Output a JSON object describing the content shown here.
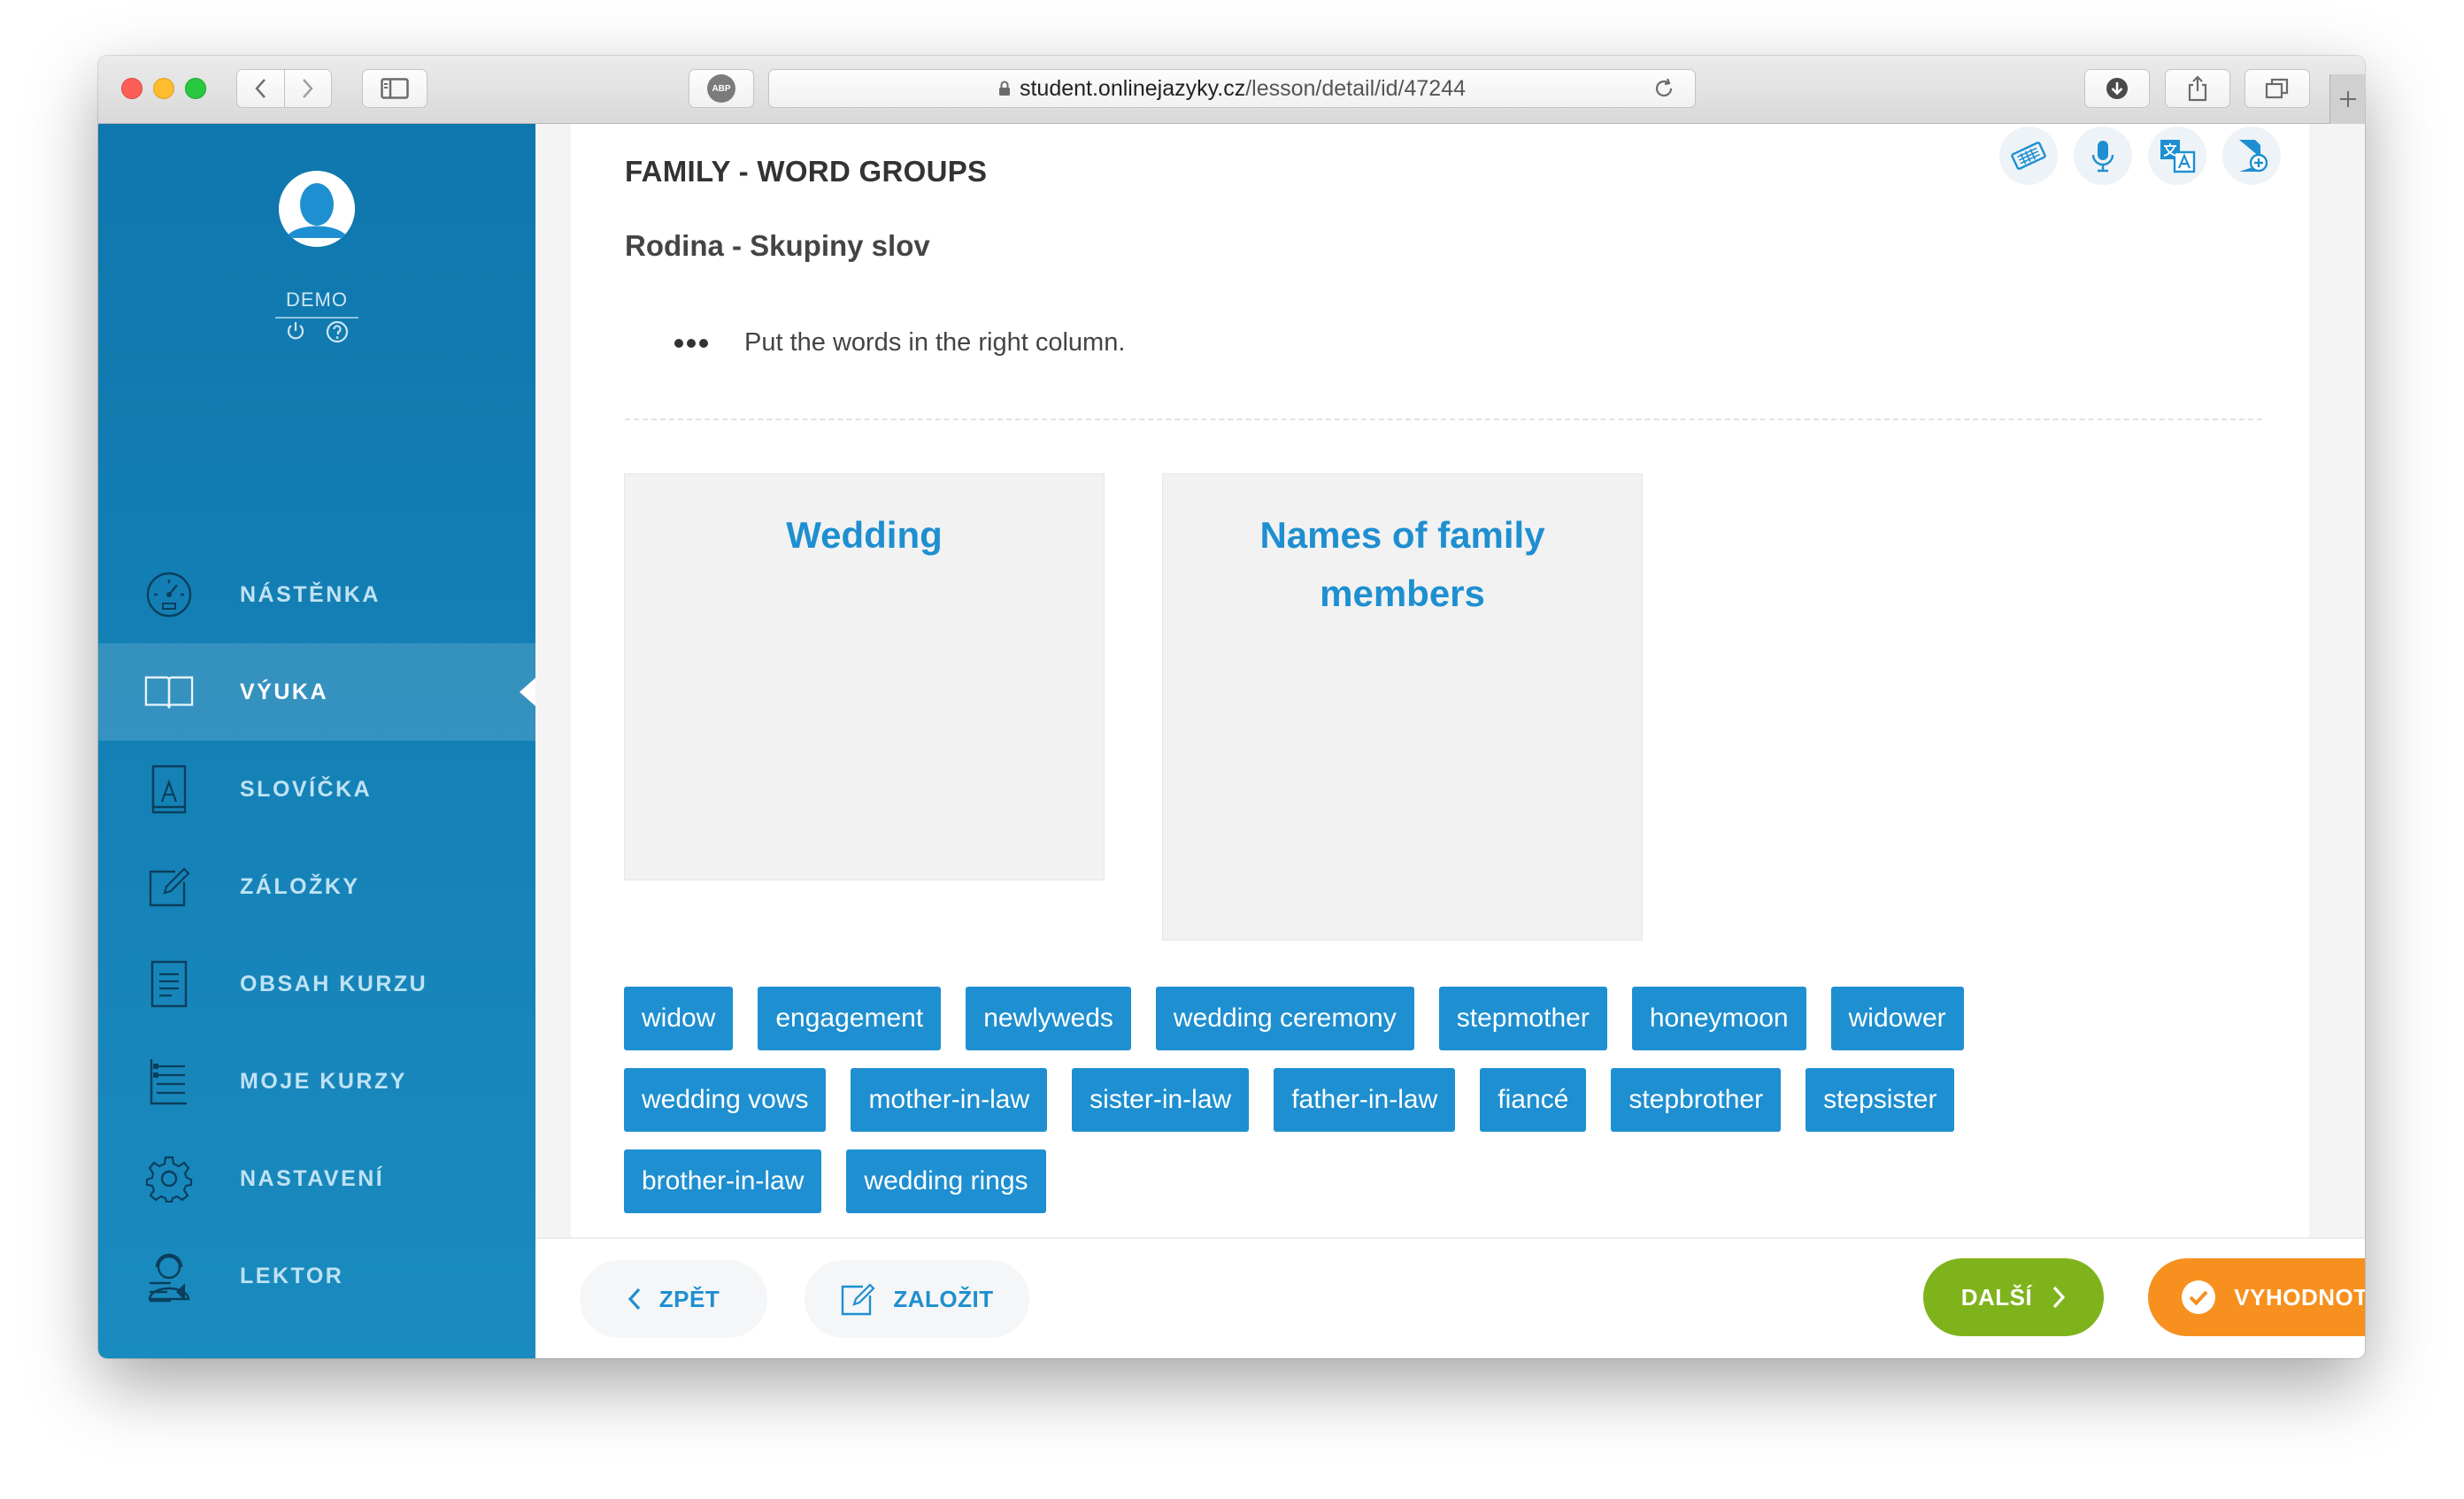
{
  "browser": {
    "url_host": "student.onlinejazyky.cz",
    "url_path": "/lesson/detail/id/47244",
    "adblock_label": "ABP"
  },
  "user": {
    "name": "DEMO"
  },
  "sidebar": {
    "items": [
      {
        "label": "NÁSTĚNKA",
        "icon": "dashboard-icon"
      },
      {
        "label": "VÝUKA",
        "icon": "book-icon",
        "active": true
      },
      {
        "label": "SLOVÍČKA",
        "icon": "vocabulary-icon"
      },
      {
        "label": "ZÁLOŽKY",
        "icon": "bookmark-edit-icon"
      },
      {
        "label": "OBSAH KURZU",
        "icon": "course-content-icon"
      },
      {
        "label": "MOJE KURZY",
        "icon": "my-courses-icon"
      },
      {
        "label": "NASTAVENÍ",
        "icon": "settings-gear-icon"
      },
      {
        "label": "LEKTOR",
        "icon": "tutor-icon"
      }
    ]
  },
  "lesson": {
    "title": "FAMILY - WORD GROUPS",
    "subtitle": "Rodina - Skupiny slov",
    "instruction": "Put the words in the right column.",
    "columns": [
      {
        "heading": "Wedding"
      },
      {
        "heading": "Names of family members"
      }
    ],
    "words": [
      [
        "widow",
        "engagement",
        "newlyweds",
        "wedding ceremony",
        "stepmother",
        "honeymoon",
        "widower"
      ],
      [
        "wedding vows",
        "mother-in-law",
        "sister-in-law",
        "father-in-law",
        "fiancé",
        "stepbrother",
        "stepsister"
      ],
      [
        "brother-in-law",
        "wedding rings"
      ]
    ]
  },
  "footer": {
    "back_label": "ZPĚT",
    "bookmark_label": "ZALOŽIT",
    "next_label": "DALŠÍ",
    "evaluate_label": "VYHODNOTIT"
  },
  "colors": {
    "sidebar": "#0f77ad",
    "accent_blue": "#1e8fd0",
    "next_green": "#7fb31c",
    "evaluate_orange": "#f7901e"
  }
}
